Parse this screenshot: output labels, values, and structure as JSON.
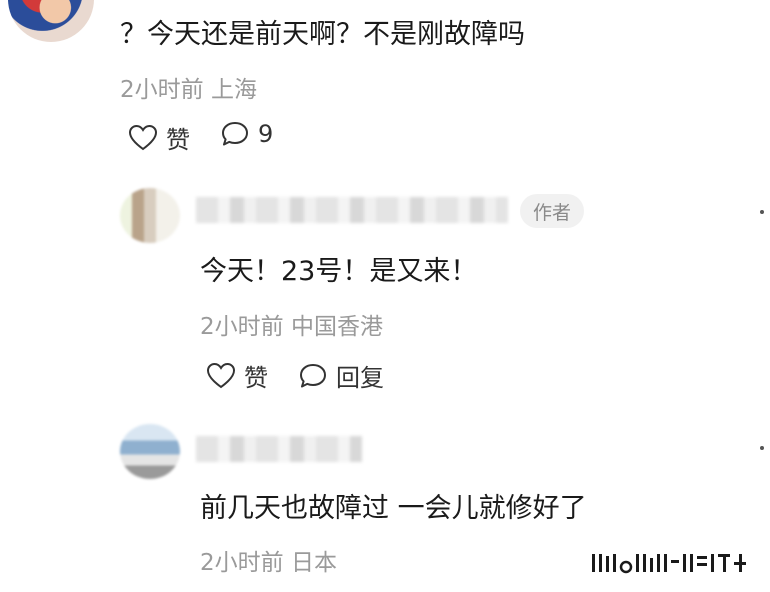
{
  "comment": {
    "text": "？今天还是前天啊？不是刚故障吗",
    "time": "2小时前",
    "location": "上海",
    "like_label": "赞",
    "reply_count": "9"
  },
  "replies": [
    {
      "author_badge": "作者",
      "text": "今天！23号！是又来！",
      "time": "2小时前",
      "location": "中国香港",
      "like_label": "赞",
      "reply_label": "回复"
    },
    {
      "text": "前几天也故障过 一会儿就修好了",
      "time": "2小时前",
      "location": "日本"
    }
  ],
  "icons": {
    "like": "heart-outline-icon",
    "comment": "speech-bubble-icon",
    "more": "more-dots-icon"
  },
  "colors": {
    "text": "#1a1a1a",
    "meta": "#9a9a9a",
    "badge_bg": "#f1f1f1"
  }
}
